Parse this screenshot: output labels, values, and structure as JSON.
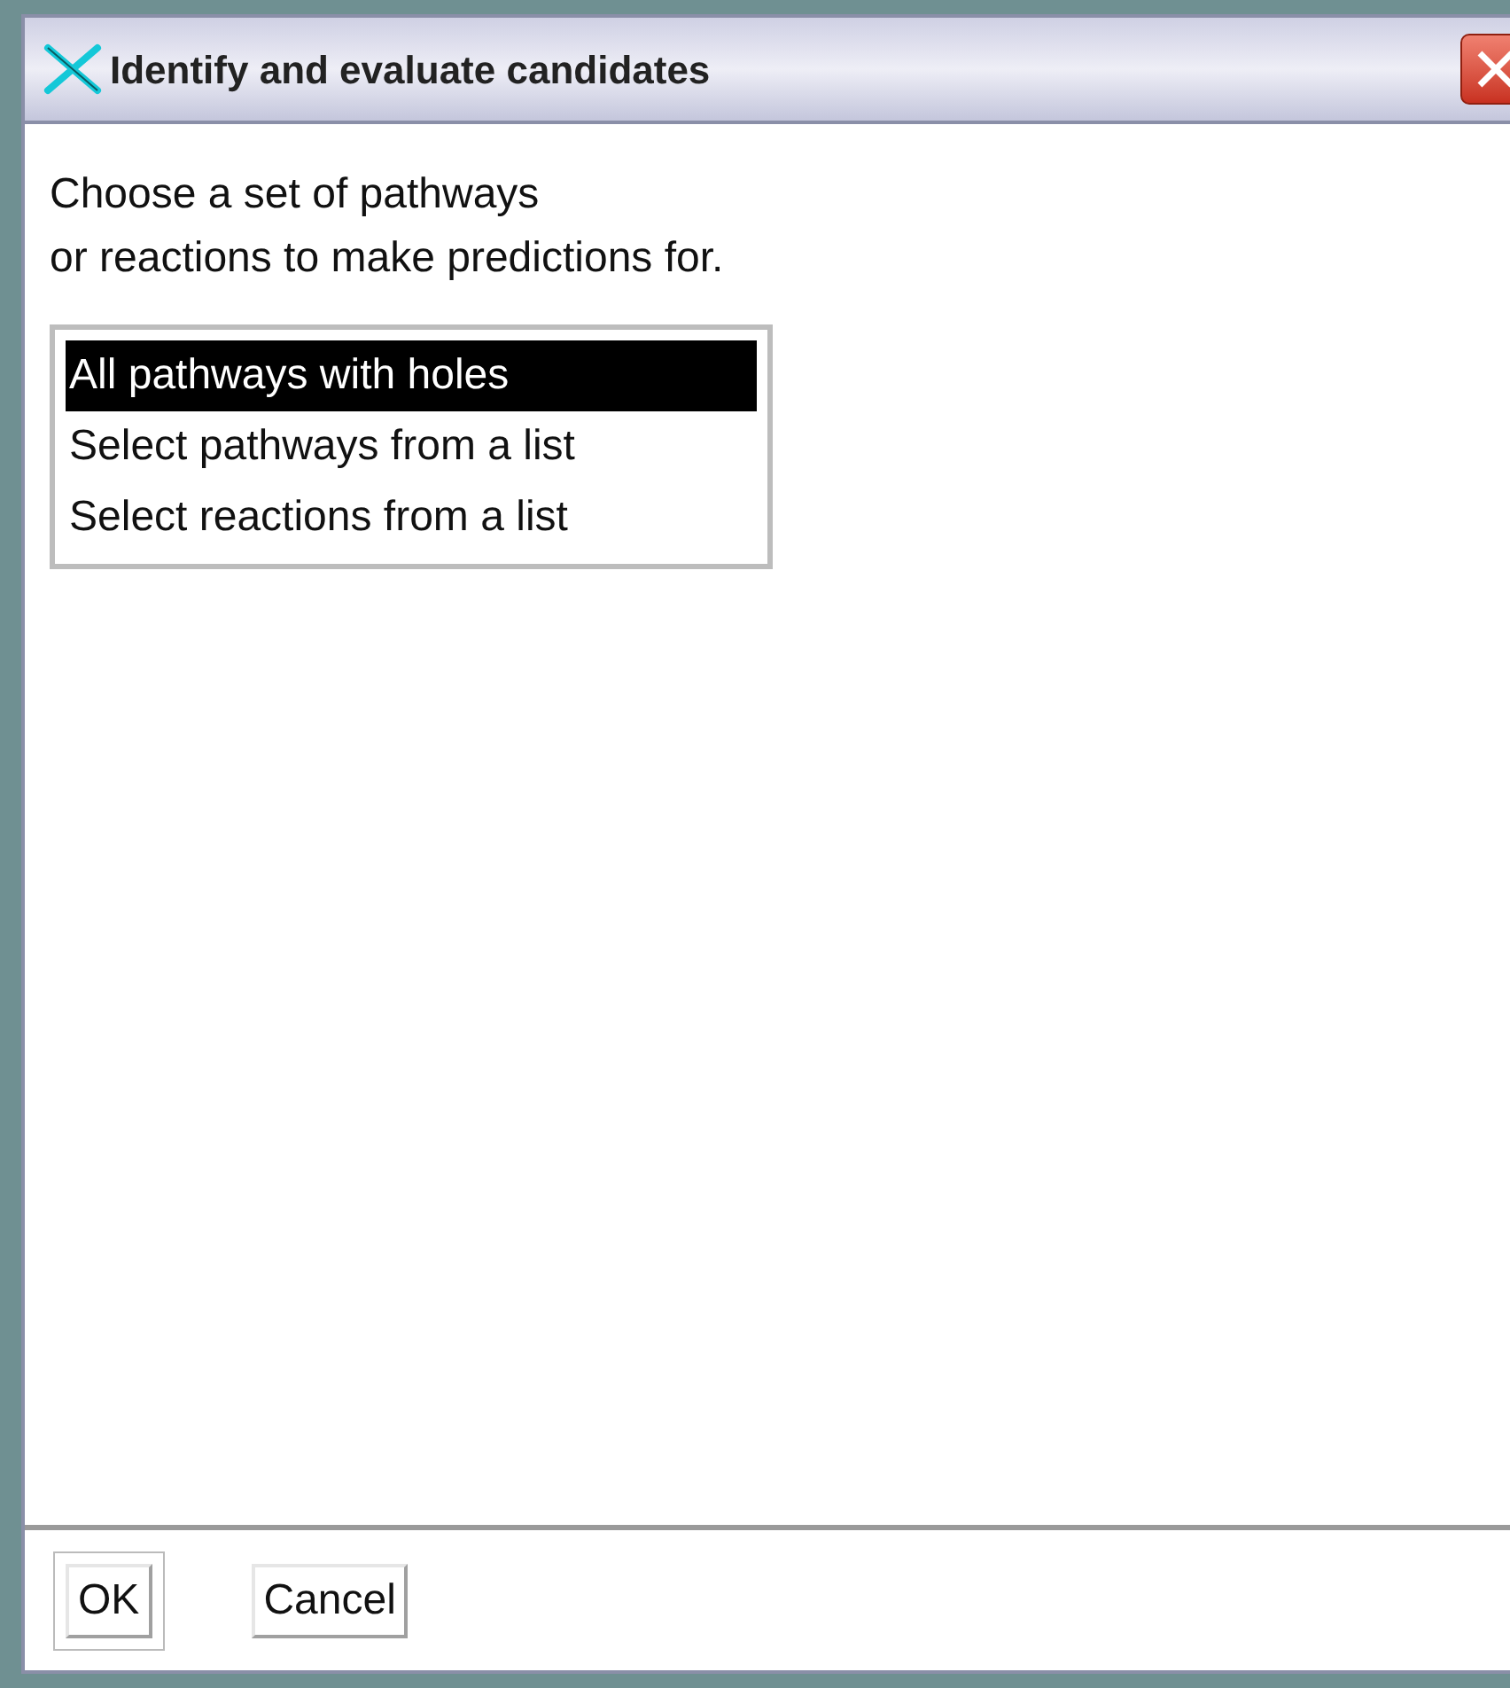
{
  "window": {
    "title": "Identify and evaluate candidates"
  },
  "prompt_lines": [
    "Choose a set of pathways",
    "or reactions to make predictions for."
  ],
  "options": [
    {
      "label": "All pathways with holes",
      "selected": true
    },
    {
      "label": "Select pathways from a list",
      "selected": false
    },
    {
      "label": "Select reactions from a list",
      "selected": false
    }
  ],
  "buttons": [
    {
      "label": "OK",
      "default": true
    },
    {
      "label": "Cancel",
      "default": false
    }
  ]
}
